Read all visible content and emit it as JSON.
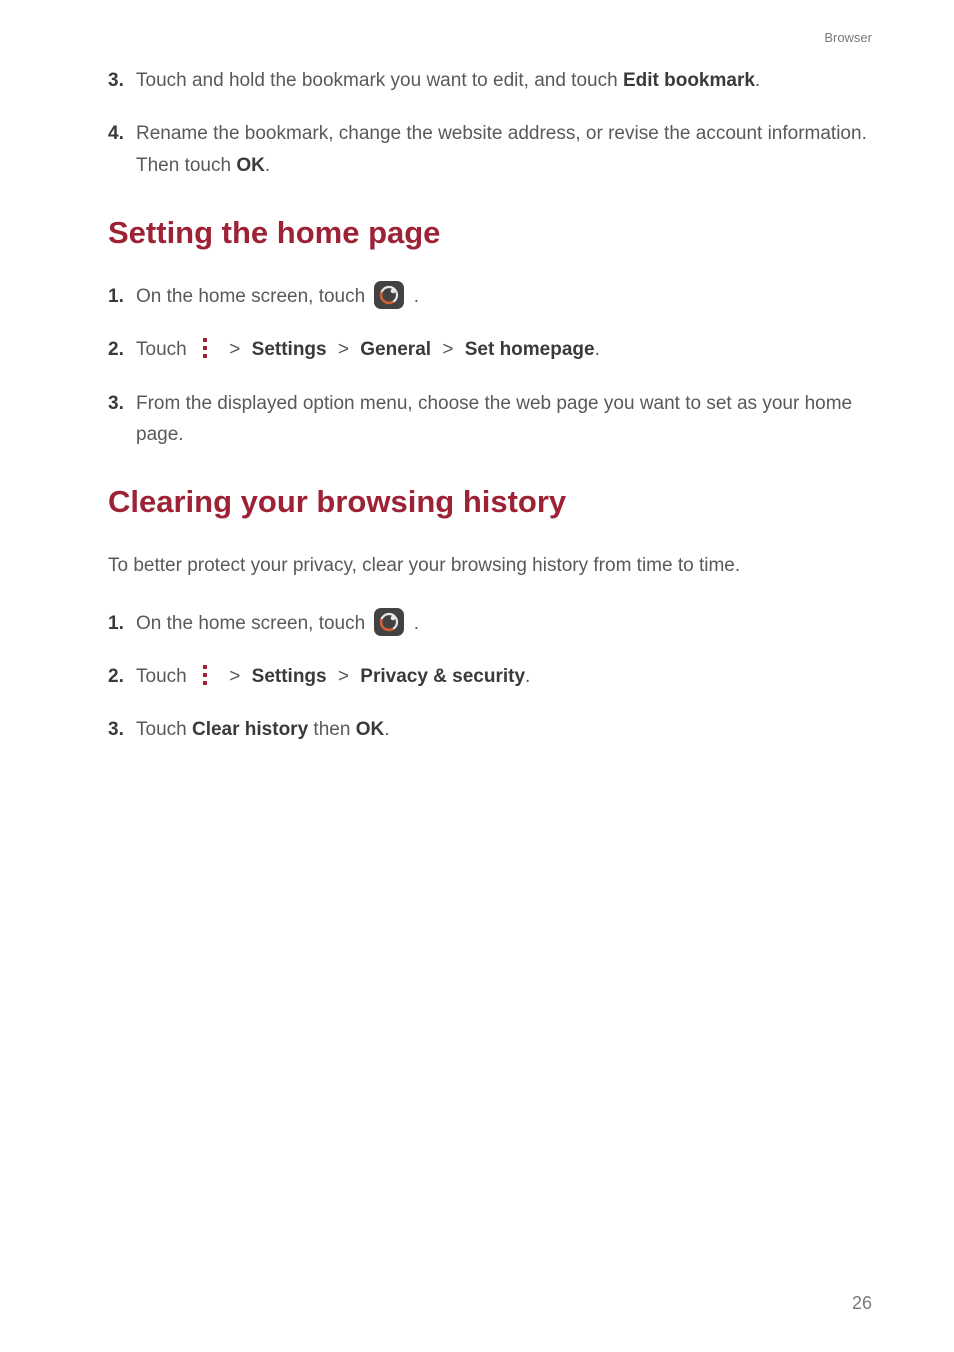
{
  "header": {
    "section_label": "Browser"
  },
  "intro_steps": [
    {
      "num": "3.",
      "parts": [
        {
          "t": "Touch and hold the bookmark you want to edit, and touch ",
          "b": false
        },
        {
          "t": "Edit bookmark",
          "b": true
        },
        {
          "t": ".",
          "b": false
        }
      ]
    },
    {
      "num": "4.",
      "parts": [
        {
          "t": "Rename the bookmark, change the website address, or revise the account information. Then touch ",
          "b": false
        },
        {
          "t": "OK",
          "b": true
        },
        {
          "t": ".",
          "b": false
        }
      ]
    }
  ],
  "section1": {
    "heading": "Setting the home page",
    "steps": {
      "s1": {
        "num": "1.",
        "before": "On the home screen, touch ",
        "after": "."
      },
      "s2": {
        "num": "2.",
        "touch_label": "Touch ",
        "path": {
          "settings": "Settings",
          "general": "General",
          "set_homepage": "Set homepage"
        },
        "trail": "."
      },
      "s3": {
        "num": "3.",
        "text": "From the displayed option menu, choose the web page you want to set as your home page."
      }
    }
  },
  "section2": {
    "heading": "Clearing your browsing history",
    "intro": "To better protect your privacy, clear your browsing history from time to time.",
    "steps": {
      "s1": {
        "num": "1.",
        "before": "On the home screen, touch ",
        "after": "."
      },
      "s2": {
        "num": "2.",
        "touch_label": "Touch ",
        "path": {
          "settings": "Settings",
          "privacy": "Privacy & security"
        },
        "trail": "."
      },
      "s3": {
        "num": "3.",
        "parts": {
          "p1": "Touch ",
          "b1": "Clear history",
          "p2": " then ",
          "b2": "OK",
          "p3": "."
        }
      }
    }
  },
  "page_number": "26",
  "gt": ">"
}
